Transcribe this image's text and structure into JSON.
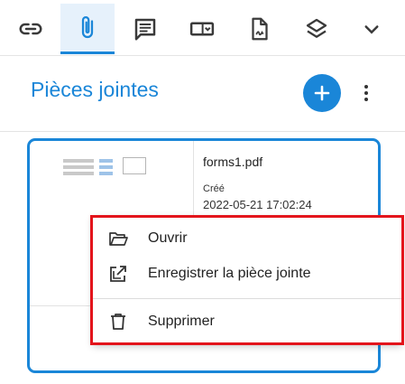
{
  "toolbar": {
    "items": [
      {
        "name": "link-icon"
      },
      {
        "name": "paperclip-icon",
        "active": true
      },
      {
        "name": "comment-icon"
      },
      {
        "name": "form-field-icon"
      },
      {
        "name": "signature-icon"
      },
      {
        "name": "layers-icon"
      },
      {
        "name": "chevron-down-icon"
      }
    ]
  },
  "panel": {
    "title": "Pièces jointes",
    "add_icon": "plus-icon",
    "more_icon": "more-vertical-icon"
  },
  "attachment": {
    "file_name": "forms1.pdf",
    "created_label": "Créé",
    "created_date": "2022-05-21 17:02:24"
  },
  "context_menu": {
    "items": [
      {
        "label": "Ouvrir",
        "icon": "folder-open-icon"
      },
      {
        "label": "Enregistrer la pièce jointe",
        "icon": "export-icon"
      },
      {
        "label": "Supprimer",
        "icon": "trash-icon"
      }
    ]
  },
  "colors": {
    "accent": "#1a86d8",
    "highlight": "#e3141b"
  }
}
